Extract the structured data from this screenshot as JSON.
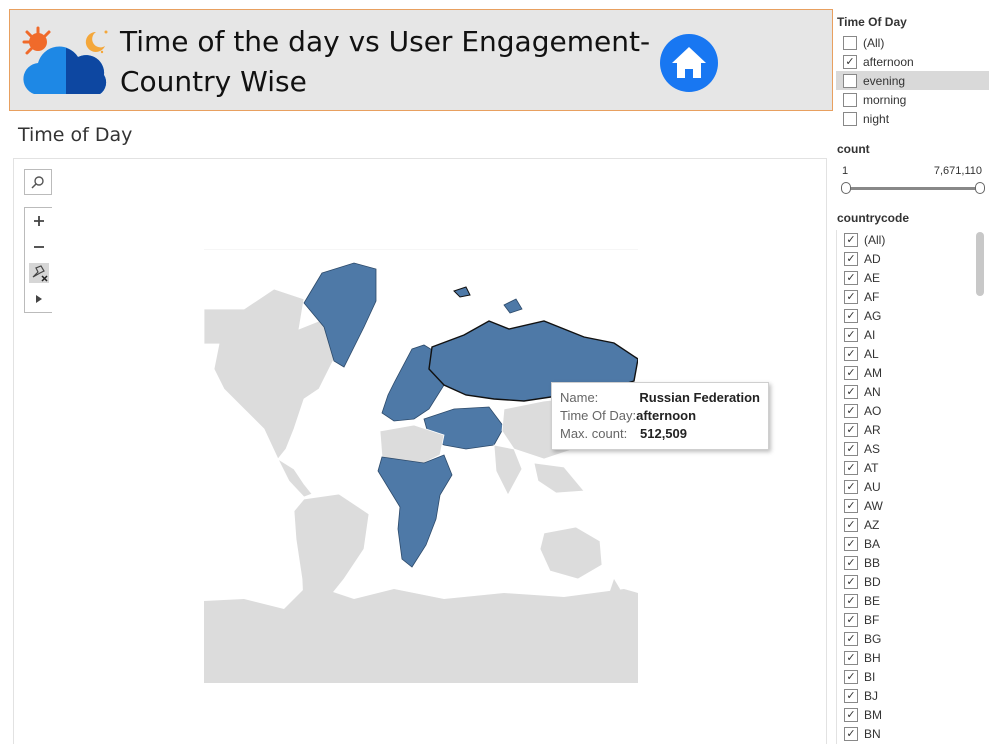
{
  "header": {
    "title": "Time of the day vs User Engagement- Country Wise",
    "logo_icon": "weather-sun-moon-cloud-icon",
    "home_icon": "home-icon"
  },
  "section": {
    "title": "Time of Day"
  },
  "map": {
    "highlight_color": "#4e79a7",
    "base_color": "#dcdcdc",
    "tools": [
      "search-icon",
      "zoom-in-icon",
      "zoom-out-icon",
      "unpin-icon",
      "play-icon"
    ],
    "tooltip": {
      "name_key": "Name:",
      "name_val": "Russian Federation",
      "tod_key": "Time Of Day:",
      "tod_val": "afternoon",
      "count_key": "Max. count:",
      "count_val": "512,509"
    }
  },
  "filters": {
    "time_of_day": {
      "title": "Time Of Day",
      "options": [
        {
          "label": "(All)",
          "checked": false
        },
        {
          "label": "afternoon",
          "checked": true
        },
        {
          "label": "evening",
          "checked": false
        },
        {
          "label": "morning",
          "checked": false
        },
        {
          "label": "night",
          "checked": false
        }
      ]
    },
    "count": {
      "title": "count",
      "min": "1",
      "max": "7,671,110"
    },
    "countrycode": {
      "title": "countrycode",
      "options": [
        "(All)",
        "AD",
        "AE",
        "AF",
        "AG",
        "AI",
        "AL",
        "AM",
        "AN",
        "AO",
        "AR",
        "AS",
        "AT",
        "AU",
        "AW",
        "AZ",
        "BA",
        "BB",
        "BD",
        "BE",
        "BF",
        "BG",
        "BH",
        "BI",
        "BJ",
        "BM",
        "BN"
      ]
    }
  }
}
